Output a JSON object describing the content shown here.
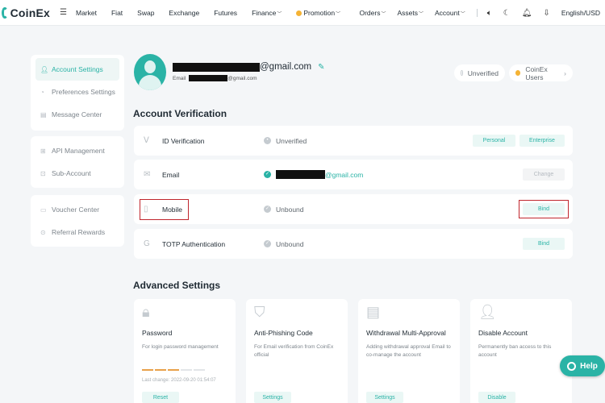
{
  "brand": {
    "name": "CoinEx",
    "accent": "#2ab3a6"
  },
  "nav": {
    "left": [
      "Market",
      "Fiat",
      "Swap",
      "Exchange",
      "Futures",
      "Finance",
      "Promotion"
    ],
    "right": [
      "Orders",
      "Assets",
      "Account"
    ],
    "language": "English/USD",
    "icons": [
      "menu-icon",
      "speaker-icon",
      "moon-icon",
      "bell-icon",
      "download-icon"
    ]
  },
  "sidebar": {
    "group1": [
      "Account Settings",
      "Preferences Settings",
      "Message Center"
    ],
    "group2": [
      "API Management",
      "Sub-Account"
    ],
    "group3": [
      "Voucher Center",
      "Referral Rewards"
    ],
    "active": "Account Settings"
  },
  "profile": {
    "email_suffix": "@gmail.com",
    "sub_label": "Email",
    "sub_suffix": "@gmail.com",
    "unverified_pill": "Unverified",
    "tier_pill": "CoinEx Users"
  },
  "verification": {
    "title": "Account Verification",
    "rows": [
      {
        "name": "ID Verification",
        "status": "Unverified",
        "buttons": [
          "Personal",
          "Enterprise"
        ]
      },
      {
        "name": "Email",
        "status_suffix": "@gmail.com",
        "buttons": [
          "Change"
        ]
      },
      {
        "name": "Mobile",
        "status": "Unbound",
        "buttons": [
          "Bind"
        ]
      },
      {
        "name": "TOTP Authentication",
        "status": "Unbound",
        "buttons": [
          "Bind"
        ]
      }
    ]
  },
  "advanced": {
    "title": "Advanced Settings",
    "cards": [
      {
        "title": "Password",
        "desc": "For login password management",
        "last_change": "Last change: 2022-09-20 01:54:07",
        "button": "Reset"
      },
      {
        "title": "Anti-Phishing Code",
        "desc": "For Email verification from CoinEx official",
        "button": "Settings"
      },
      {
        "title": "Withdrawal Multi-Approval",
        "desc": "Adding withdrawal approval Email to co-manage the account",
        "button": "Settings"
      },
      {
        "title": "Disable Account",
        "desc": "Permanently ban access to this account",
        "button": "Disable"
      }
    ]
  },
  "help": {
    "label": "Help"
  }
}
